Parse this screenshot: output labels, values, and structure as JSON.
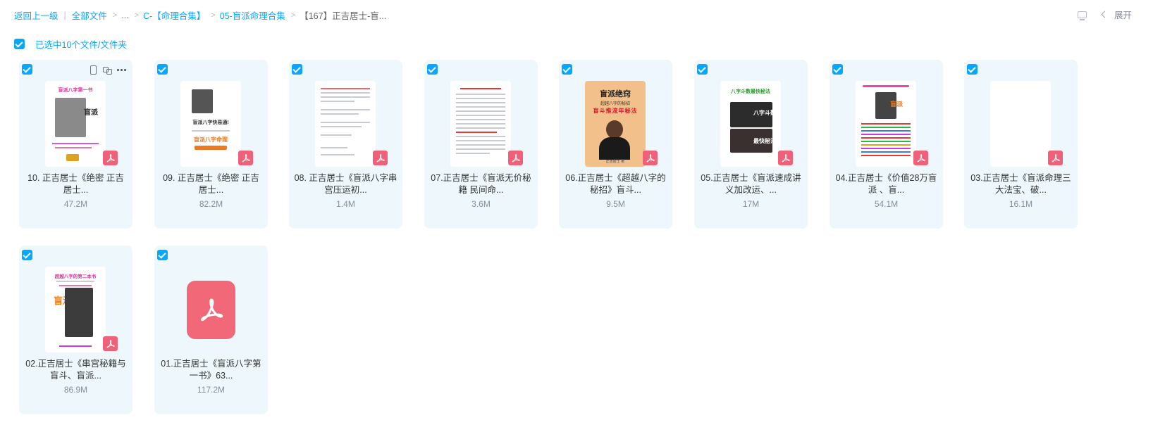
{
  "breadcrumb": {
    "back": "返回上一级",
    "all_files": "全部文件",
    "ellipsis": "...",
    "level1": "C-【命理合集】",
    "level2": "05-盲派命理合集",
    "current": "【167】正吉居士-盲..."
  },
  "topright": {
    "expand": "展开"
  },
  "selection": {
    "text": "已选中10个文件/文件夹"
  },
  "files": [
    {
      "name": "10. 正吉居士《绝密 正吉居士...",
      "size": "47.2M",
      "thumb_text": [
        "盲派八字第一书",
        "盲派"
      ]
    },
    {
      "name": "09. 正吉居士《绝密 正吉居士...",
      "size": "82.2M",
      "thumb_text": [
        "盲派八字快易通!",
        "盲派八字命理"
      ]
    },
    {
      "name": "08. 正吉居士《盲派八字串宫压运初...",
      "size": "1.4M"
    },
    {
      "name": "07.正吉居士《盲派无价秘籍 民间命...",
      "size": "3.6M"
    },
    {
      "name": "06.正吉居士《超越八字的秘招》盲斗...",
      "size": "9.5M",
      "thumb_text": [
        "盲派绝窍",
        "超越八字的秘招",
        "盲斗推流年秘法",
        "正吉居士 著"
      ]
    },
    {
      "name": "05.正吉居士《盲派速成讲义加改运、...",
      "size": "17M",
      "thumb_text": [
        "八字斗数最快秘法",
        "八字斗数",
        "最快秘法"
      ]
    },
    {
      "name": "04.正吉居士《价值28万盲派 、盲...",
      "size": "54.1M",
      "thumb_text": [
        "盲派"
      ]
    },
    {
      "name": "03.正吉居士《盲派命理三大法宝、破...",
      "size": "16.1M"
    },
    {
      "name": "02.正吉居士《串宫秘籍与盲斗、盲派...",
      "size": "86.9M",
      "thumb_text": [
        "超越八字的第二本书",
        "盲派"
      ]
    },
    {
      "name": "01.正吉居士《盲派八字第一书》63...",
      "size": "117.2M"
    }
  ],
  "colors": {
    "accent": "#06a7ff",
    "card_bg": "#eef7fc",
    "pdf": "#ef6079"
  },
  "icons": [
    "monitor-icon",
    "chevron-left-icon",
    "phone-icon",
    "link-icon",
    "more-icon",
    "pdf-icon",
    "checkbox-icon"
  ]
}
